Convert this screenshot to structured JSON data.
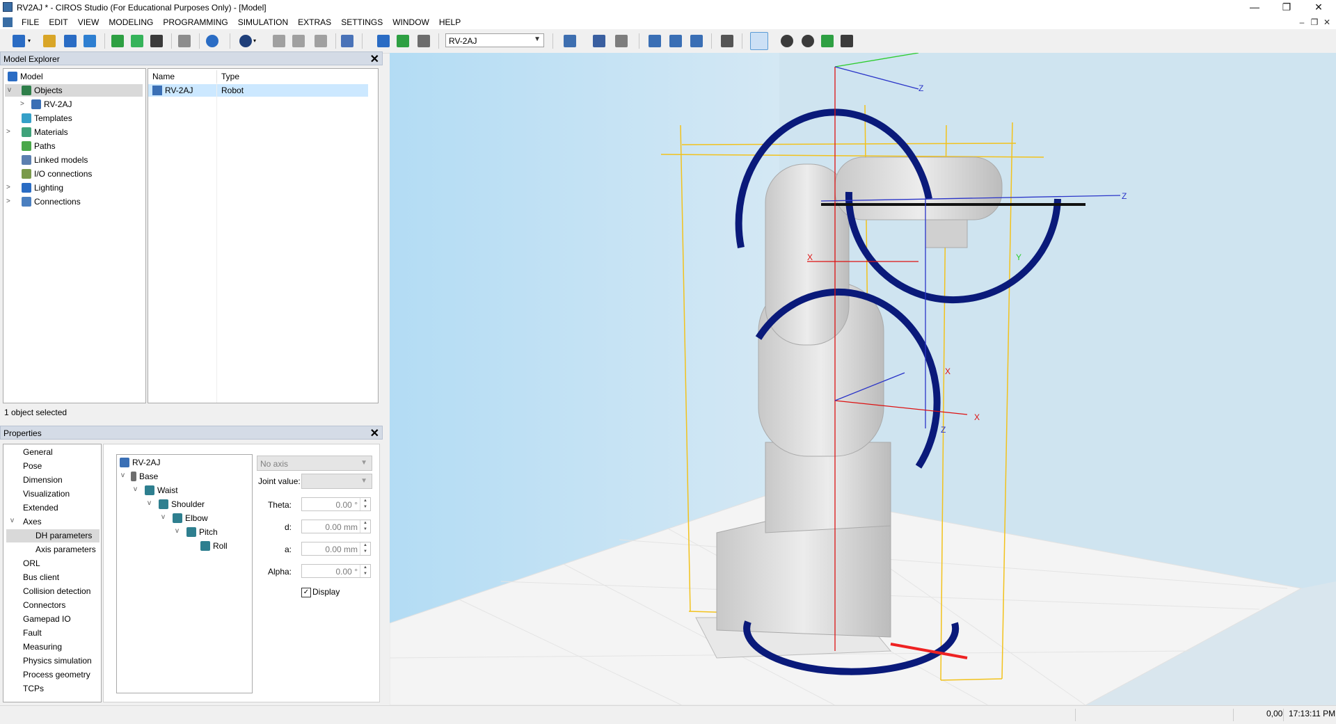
{
  "window": {
    "title": "RV2AJ * - CIROS Studio (For Educational Purposes Only) - [Model]",
    "min_glyph": "—",
    "restore_glyph": "❐",
    "close_glyph": "✕"
  },
  "menu": [
    "FILE",
    "EDIT",
    "VIEW",
    "MODELING",
    "PROGRAMMING",
    "SIMULATION",
    "EXTRAS",
    "SETTINGS",
    "WINDOW",
    "HELP"
  ],
  "mdi_controls": {
    "min": "–",
    "restore": "❐",
    "close": "✕"
  },
  "toolbar": {
    "robot_select": "RV-2AJ",
    "colors": {
      "blue": "#2a6cc4",
      "green": "#2ea043",
      "gray": "#6d6d6d",
      "accent": "#3a7bd5"
    }
  },
  "model_explorer": {
    "title": "Model Explorer",
    "close": "✕",
    "tree": {
      "root": "Model",
      "objects": "Objects",
      "robot": "RV-2AJ",
      "items": [
        "Templates",
        "Materials",
        "Paths",
        "Linked models",
        "I/O connections",
        "Lighting",
        "Connections"
      ]
    },
    "list": {
      "col_name": "Name",
      "col_type": "Type",
      "row_name": "RV-2AJ",
      "row_type": "Robot"
    },
    "status": "1 object selected"
  },
  "properties": {
    "title": "Properties",
    "close": "✕",
    "items": [
      "General",
      "Pose",
      "Dimension",
      "Visualization",
      "Extended",
      "Axes",
      "DH parameters",
      "Axis parameters",
      "ORL",
      "Bus client",
      "Collision detection",
      "Connectors",
      "Gamepad IO",
      "Fault",
      "Measuring",
      "Physics simulation",
      "Process geometry",
      "TCPs"
    ],
    "axis_tree": [
      "RV-2AJ",
      "Base",
      "Waist",
      "Shoulder",
      "Elbow",
      "Pitch",
      "Roll"
    ],
    "axis_select": "No axis",
    "joint_value_label": "Joint value:",
    "theta_label": "Theta:",
    "theta": "0.00 °",
    "d_label": "d:",
    "d": "0.00 mm",
    "a_label": "a:",
    "a": "0.00 mm",
    "alpha_label": "Alpha:",
    "alpha": "0.00 °",
    "display_label": "Display"
  },
  "viewport": {
    "axis_labels": {
      "x1": "X",
      "x2": "X",
      "x3": "X",
      "y": "Y",
      "z1": "Z",
      "z2": "Z",
      "z3": "Z"
    },
    "colors": {
      "sky": "#b9dcf2",
      "floor": "#f6f6f6",
      "gauge": "#0a1a7a",
      "robot": "#dcdcdc"
    }
  },
  "statusbar": {
    "coord": "0,00",
    "time": "17:13:11 PM"
  }
}
